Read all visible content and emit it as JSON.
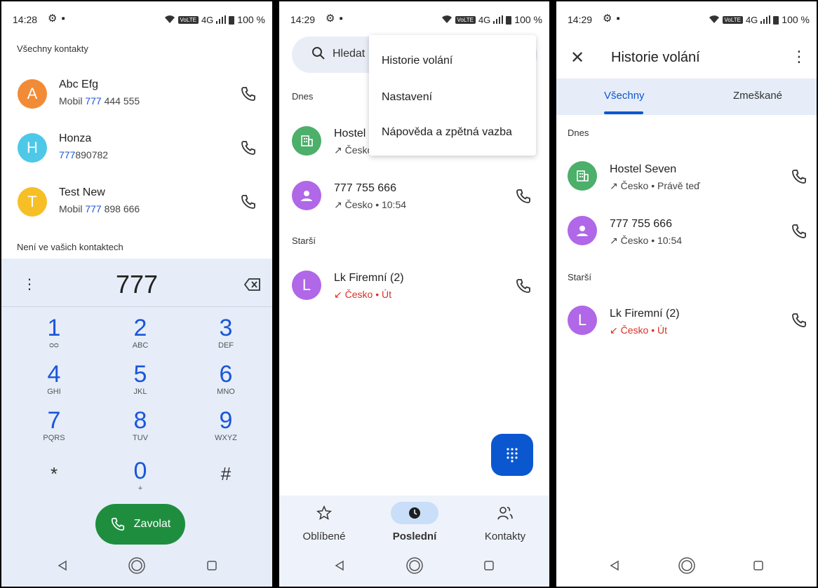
{
  "panels": {
    "p1": {
      "status": {
        "time": "14:28",
        "battery": "100 %",
        "network": "4G"
      },
      "all_contacts_header": "Všechny kontakty",
      "contacts": [
        {
          "initial": "A",
          "color": "#f28b36",
          "name": "Abc Efg",
          "number_prefix": "Mobil ",
          "number_hl": "777",
          "number_rest": " 444 555"
        },
        {
          "initial": "H",
          "color": "#4dc8e8",
          "name": "Honza",
          "number_prefix": "",
          "number_hl": "777",
          "number_rest": "890782"
        },
        {
          "initial": "T",
          "color": "#f6bf26",
          "name": "Test New",
          "number_prefix": "Mobil ",
          "number_hl": "777",
          "number_rest": " 898 666"
        }
      ],
      "not_in_contacts_header": "Není ve vašich kontaktech",
      "dialpad": {
        "number": "777",
        "keys": [
          {
            "d": "1",
            "l": "ᴑᴑ"
          },
          {
            "d": "2",
            "l": "ABC"
          },
          {
            "d": "3",
            "l": "DEF"
          },
          {
            "d": "4",
            "l": "GHI"
          },
          {
            "d": "5",
            "l": "JKL"
          },
          {
            "d": "6",
            "l": "MNO"
          },
          {
            "d": "7",
            "l": "PQRS"
          },
          {
            "d": "8",
            "l": "TUV"
          },
          {
            "d": "9",
            "l": "WXYZ"
          },
          {
            "d": "*",
            "l": ""
          },
          {
            "d": "0",
            "l": "+"
          },
          {
            "d": "#",
            "l": ""
          }
        ],
        "call_label": "Zavolat"
      }
    },
    "p2": {
      "status": {
        "time": "14:29",
        "battery": "100 %",
        "network": "4G"
      },
      "search_placeholder": "Hledat",
      "menu": [
        "Historie volání",
        "Nastavení",
        "Nápověda a zpětná vazba"
      ],
      "today": "Dnes",
      "older": "Starší",
      "calls": [
        {
          "name": "Hostel",
          "sub": "↗ Česko",
          "avatar_color": "#4caf6a"
        },
        {
          "name": "777 755 666",
          "sub": "↗ Česko • 10:54",
          "avatar_color": "#b067e8"
        },
        {
          "name": "Lk Firemní  (2)",
          "sub": "↙ Česko • Út",
          "avatar_color": "#b067e8",
          "initial": "L",
          "missed": true
        }
      ],
      "bottom_nav": {
        "favorites": "Oblíbené",
        "recent": "Poslední",
        "contacts": "Kontakty"
      }
    },
    "p3": {
      "status": {
        "time": "14:29",
        "battery": "100 %",
        "network": "4G"
      },
      "title": "Historie volání",
      "tabs": {
        "all": "Všechny",
        "missed": "Zmeškané"
      },
      "today": "Dnes",
      "older": "Starší",
      "calls": [
        {
          "name": "Hostel Seven",
          "sub": "↗ Česko • Právě teď"
        },
        {
          "name": "777 755 666",
          "sub": "↗ Česko • 10:54"
        },
        {
          "name": "Lk Firemní  (2)",
          "sub": "↙ Česko • Út",
          "initial": "L"
        }
      ]
    }
  }
}
